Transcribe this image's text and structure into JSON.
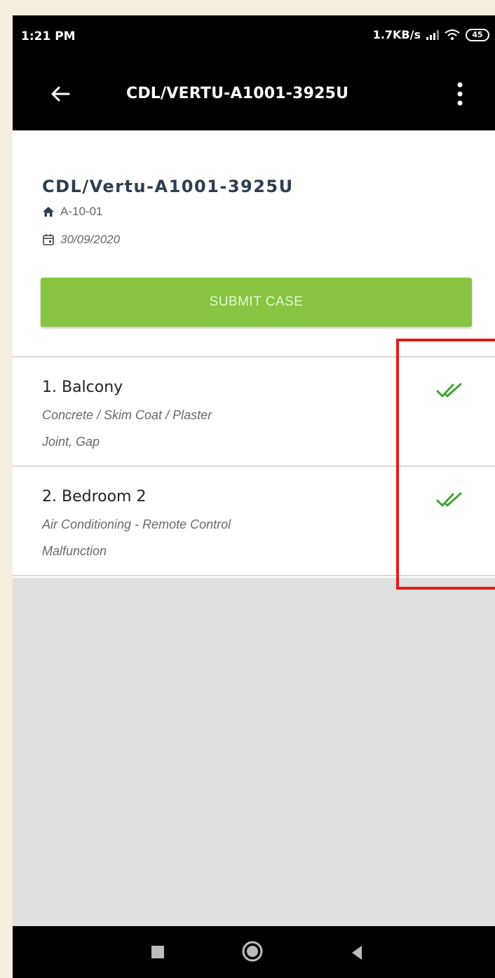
{
  "status_bar": {
    "time": "1:21 PM",
    "net_speed": "1.7KB/s",
    "battery": "45",
    "icons": [
      "signal-icon",
      "wifi-icon",
      "battery-icon"
    ]
  },
  "app_bar": {
    "title": "CDL/VERTU-A1001-3925U",
    "icons": [
      "back-arrow-icon",
      "more-vert-icon"
    ]
  },
  "case": {
    "title": "CDL/Vertu-A1001-3925U",
    "unit": "A-10-01",
    "date": "30/09/2020",
    "submit_label": "SUBMIT CASE",
    "icons": [
      "home-icon",
      "calendar-icon"
    ]
  },
  "items": [
    {
      "title": "1. Balcony",
      "line1": "Concrete / Skim Coat / Plaster",
      "line2": "Joint, Gap",
      "status_icon": "double-check-icon"
    },
    {
      "title": "2. Bedroom 2",
      "line1": "Air Conditioning - Remote Control",
      "line2": "Malfunction",
      "status_icon": "double-check-icon"
    }
  ],
  "colors": {
    "accent_green": "#86c441",
    "check_green": "#3fa535",
    "highlight_red": "#e51a1a",
    "title_navy": "#2c3e50"
  }
}
